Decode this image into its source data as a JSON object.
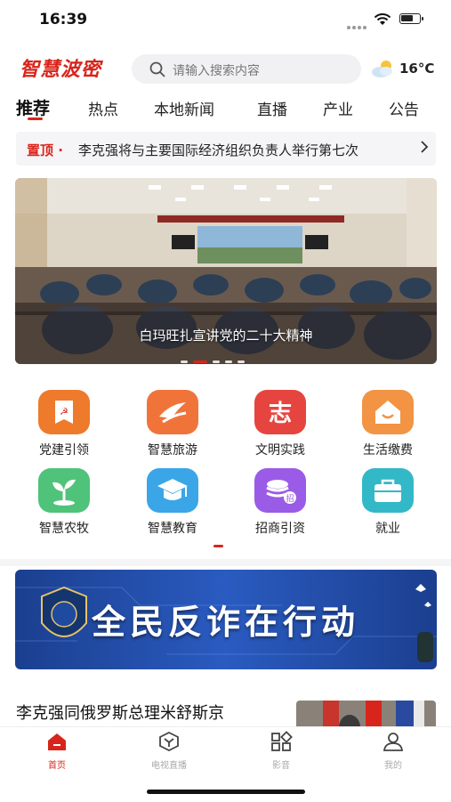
{
  "status": {
    "time": "16:39"
  },
  "header": {
    "logo": "智慧波密",
    "search_placeholder": "请输入搜索内容",
    "temperature": "16°C",
    "weather_icon": "partly-cloudy-icon"
  },
  "tabs": [
    "推荐",
    "热点",
    "本地新闻",
    "直播",
    "产业",
    "公告"
  ],
  "pinned": {
    "tag": "置顶 ·",
    "text": "李克强将与主要国际经济组织负责人举行第七次"
  },
  "banner": {
    "caption": "白玛旺扎宣讲党的二十大精神"
  },
  "grid": [
    {
      "label": "党建引领",
      "icon": "party-flag-icon",
      "color": "#ee7a2c"
    },
    {
      "label": "智慧旅游",
      "icon": "travel-icon",
      "color": "#f0743a"
    },
    {
      "label": "文明实践",
      "icon": "volunteer-icon",
      "color": "#e6453f"
    },
    {
      "label": "生活缴费",
      "icon": "house-icon",
      "color": "#f29444"
    },
    {
      "label": "智慧农牧",
      "icon": "sprout-icon",
      "color": "#4fc37a"
    },
    {
      "label": "智慧教育",
      "icon": "graduation-cap-icon",
      "color": "#3aa6e8"
    },
    {
      "label": "招商引资",
      "icon": "invest-icon",
      "color": "#9a5ce6"
    },
    {
      "label": "就业",
      "icon": "briefcase-icon",
      "color": "#33b8c8"
    }
  ],
  "ad": {
    "text": "全民反诈在行动"
  },
  "news": {
    "headline": "李克强同俄罗斯总理米舒斯京"
  },
  "tabbar": [
    {
      "label": "首页",
      "icon": "home-icon"
    },
    {
      "label": "电视直播",
      "icon": "tv-icon"
    },
    {
      "label": "影音",
      "icon": "apps-grid-icon"
    },
    {
      "label": "我的",
      "icon": "user-icon"
    }
  ],
  "colors": {
    "accent": "#d8251c"
  }
}
